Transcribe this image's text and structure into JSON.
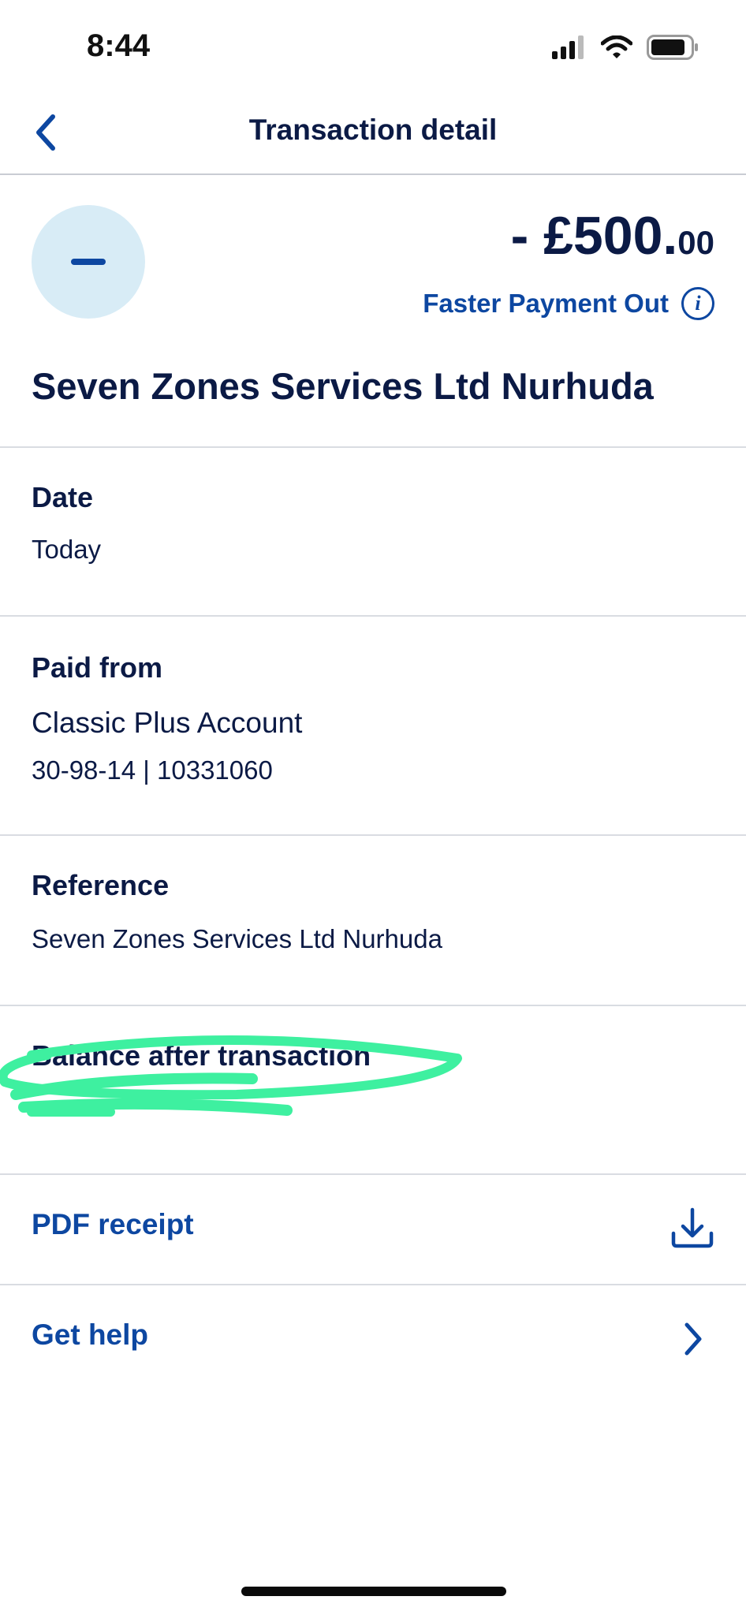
{
  "status_bar": {
    "time": "8:44"
  },
  "nav": {
    "title": "Transaction detail"
  },
  "transaction": {
    "amount_main": "- £500.",
    "amount_decimal": "00",
    "payment_type": "Faster Payment Out",
    "payee": "Seven Zones Services Ltd Nurhuda"
  },
  "details": {
    "date": {
      "label": "Date",
      "value": "Today"
    },
    "paid_from": {
      "label": "Paid from",
      "account_name": "Classic Plus Account",
      "account_number": "30-98-14 | 10331060"
    },
    "reference": {
      "label": "Reference",
      "value": "Seven Zones Services Ltd Nurhuda"
    },
    "balance": {
      "label": "Balance after transaction"
    }
  },
  "actions": {
    "pdf_receipt": "PDF receipt",
    "get_help": "Get help"
  },
  "colors": {
    "accent": "#0d47a1",
    "text": "#0b1a45",
    "circle": "#d8ecf6",
    "scribble": "#3ef0a0"
  }
}
